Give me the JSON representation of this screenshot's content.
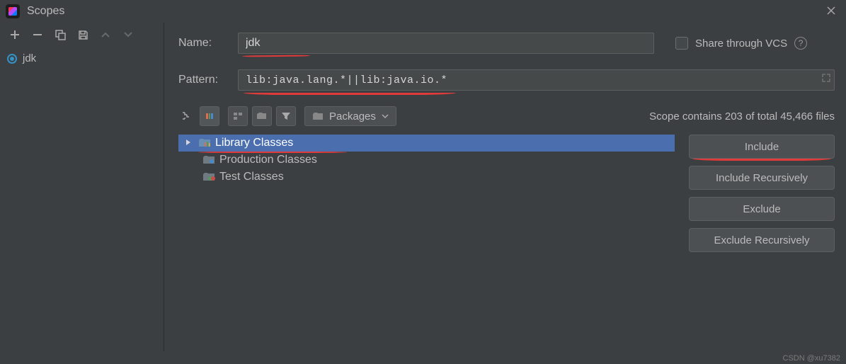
{
  "title": "Scopes",
  "sidebar": {
    "items": [
      {
        "label": "jdk"
      }
    ]
  },
  "form": {
    "name_label": "Name:",
    "name_value": "jdk",
    "share_label": "Share through VCS",
    "pattern_label": "Pattern:",
    "pattern_value": "lib:java.lang.*||lib:java.io.*"
  },
  "toolbar": {
    "packages_label": "Packages"
  },
  "status_text": "Scope contains 203 of total 45,466 files",
  "tree": {
    "items": [
      {
        "label": "Library Classes",
        "selected": true
      },
      {
        "label": "Production Classes",
        "selected": false
      },
      {
        "label": "Test Classes",
        "selected": false
      }
    ]
  },
  "actions": {
    "include": "Include",
    "include_recursive": "Include Recursively",
    "exclude": "Exclude",
    "exclude_recursive": "Exclude Recursively"
  },
  "watermark": "CSDN @xu7382"
}
